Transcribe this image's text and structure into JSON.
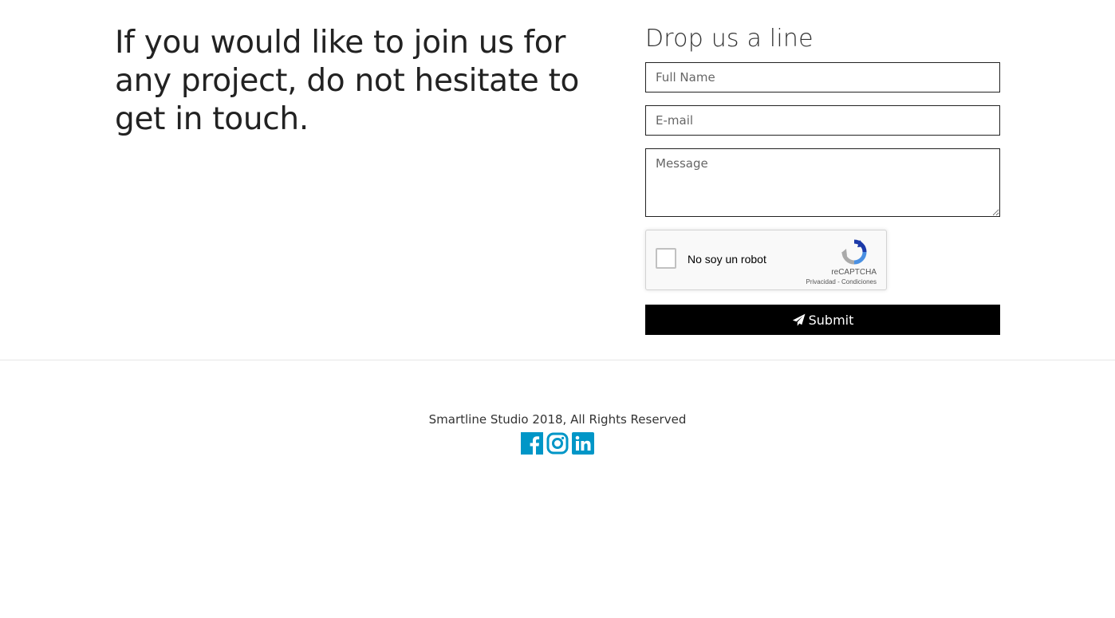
{
  "intro": {
    "text": "If you would like to join us for any project, do not hesitate to get in touch."
  },
  "contact_form": {
    "heading": "Drop us a line",
    "full_name_placeholder": "Full Name",
    "email_placeholder": "E-mail",
    "message_placeholder": "Message",
    "captcha": {
      "label": "No soy un robot",
      "brand": "reCAPTCHA",
      "terms": "Privacidad - Condiciones"
    },
    "submit_label": "Submit"
  },
  "footer": {
    "copyright": "Smartline Studio 2018, All Rights Reserved",
    "social": [
      {
        "icon": "facebook-icon"
      },
      {
        "icon": "instagram-icon"
      },
      {
        "icon": "linkedin-icon"
      }
    ],
    "accent_color": "#0096c7"
  }
}
